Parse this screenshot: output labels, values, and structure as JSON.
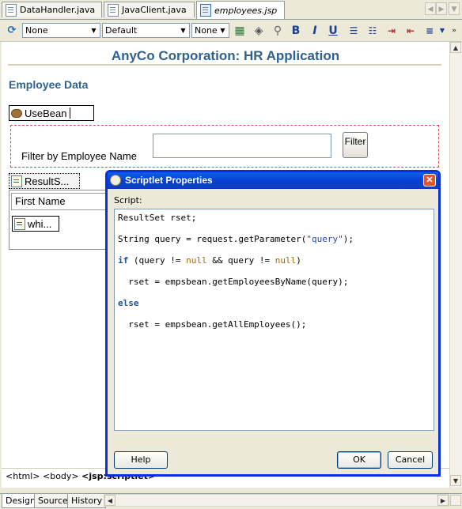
{
  "tabs": [
    {
      "label": "DataHandler.java",
      "active": false
    },
    {
      "label": "JavaClient.java",
      "active": false
    },
    {
      "label": "employees.jsp",
      "active": true
    }
  ],
  "toolbar": {
    "style_select": "None",
    "font_select": "Default",
    "size_select": "None",
    "bold_label": "B",
    "italic_label": "I",
    "underline_label": "U"
  },
  "page": {
    "title": "AnyCo Corporation: HR Application",
    "heading": "Employee Data",
    "usebean_label": "UseBean",
    "filter_label": "Filter by Employee Name",
    "filter_button": "Filter",
    "scriptlet_label": "ResultS...",
    "column_header": "First Name",
    "while_label": "whi..."
  },
  "breadcrumb": {
    "html": "<html>",
    "body": "<body>",
    "current": "<jsp:scriptlet>"
  },
  "bottom_tabs": [
    "Design",
    "Source",
    "History"
  ],
  "dialog": {
    "title": "Scriptlet Properties",
    "script_label": "Script:",
    "code": {
      "l1": "ResultSet rset;",
      "l2a": "String query = request.getParameter(",
      "l2b": "\"query\"",
      "l2c": ");",
      "l3kw": "if",
      "l3a": " (query != ",
      "l3n1": "null",
      "l3b": " && query != ",
      "l3n2": "null",
      "l3c": ")",
      "l4": "  rset = empsbean.getEmployeesByName(query);",
      "l5kw": "else",
      "l6": "  rset = empsbean.getAllEmployees();"
    },
    "help_button": "Help",
    "ok_button": "OK",
    "cancel_button": "Cancel"
  }
}
